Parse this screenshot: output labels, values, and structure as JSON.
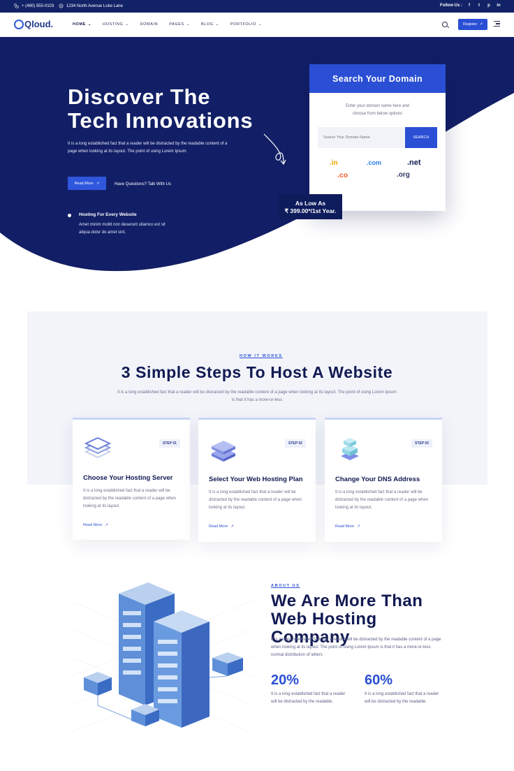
{
  "topbar": {
    "phone": "+ (480) 555-0103",
    "address": "1234 North Avenue Luke Lane",
    "follow_label": "Follow Us :",
    "social": [
      "f",
      "t",
      "p",
      "in"
    ]
  },
  "nav": {
    "logo": "Qloud.",
    "menu": [
      {
        "label": "HOME",
        "has_dropdown": true,
        "active": true
      },
      {
        "label": "HOSTING",
        "has_dropdown": true
      },
      {
        "label": "DOMAIN",
        "has_dropdown": false
      },
      {
        "label": "PAGES",
        "has_dropdown": true
      },
      {
        "label": "BLOG",
        "has_dropdown": true
      },
      {
        "label": "PORTFOLIO",
        "has_dropdown": true
      }
    ],
    "register_label": "Register",
    "icons": [
      "search-icon",
      "hamburger-icon"
    ]
  },
  "hero": {
    "title_line1": "Discover The",
    "title_line2": "Tech Innovations",
    "description": "It is a long established fact that a reader will be distracted by the readable content of a page when looking at its layout. The point of using Lorem Ipsum",
    "read_more": "Read More",
    "talk_link": "Have Questions? Talk With Us",
    "feature_title": "Hosting For Every Website",
    "feature_desc": "Amet minim mollit non deserunt ullamco est sit aliqua dolor do amet sint.",
    "price_line1": "As Low As",
    "price_line2": "₹ 399.00*/1st Year."
  },
  "domain_search": {
    "title": "Search Your Domain",
    "subtitle": "Enter your domain name here and choose from below options",
    "placeholder": "Search Your Domain Name",
    "button": "SEARCH",
    "tlds": [
      ".in",
      ".com",
      ".net",
      ".co",
      ".org"
    ],
    "colors": {
      "in": "#f0a500",
      "com": "#2a7de1",
      "net": "#111a52",
      "co": "#f05a28",
      "org": "#2b3a6a"
    }
  },
  "steps": {
    "eyebrow": "HOW IT WORKS",
    "title": "3 Simple Steps To Host A Website",
    "description": "It is a long established fact that a reader will be distracted by the readable content of a page when looking at its layout. The point of using Lorem Ipsum is that it has a more-or-less",
    "cards": [
      {
        "badge": "STEP 01",
        "title": "Choose Your Hosting Server",
        "desc": "It is a long established fact that a reader will be distracted by the readable content of a page when looking at its layout.",
        "link": "Read More"
      },
      {
        "badge": "STEP 02",
        "title": "Select Your Web Hosting Plan",
        "desc": "It is a long established fact that a reader will be distracted by the readable content of a page when looking at its layout.",
        "link": "Read More"
      },
      {
        "badge": "STEP 03",
        "title": "Change Your DNS Address",
        "desc": "It is a long established fact that a reader will be distracted by the readable content of a page when looking at its layout.",
        "link": "Read More"
      }
    ]
  },
  "about": {
    "eyebrow": "ABOUT US",
    "title_line1": "We Are More Than",
    "title_line2": "Web Hosting Company",
    "description": "It is a long established fact that a reader will be distracted by the readable content of a page when looking at its layout. The point of using Lorem Ipsum is that it has a more-or-less normal distribution of letters",
    "stats": [
      {
        "value": "20%",
        "desc": "It is a long established fact that a reader will be distracted by the readable."
      },
      {
        "value": "60%",
        "desc": "It is a long established fact that a reader will be distracted by the readable."
      }
    ]
  },
  "colors": {
    "primary": "#2a4fd5",
    "navy": "#121f66",
    "dark": "#111a52"
  }
}
